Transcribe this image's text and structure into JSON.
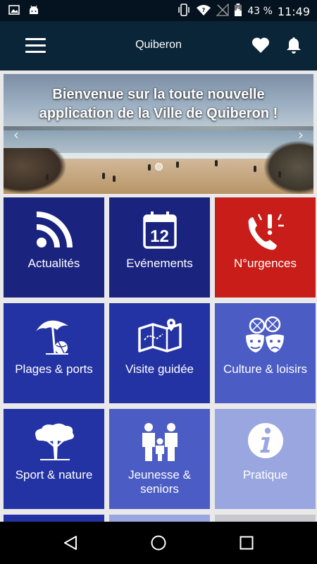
{
  "status_bar": {
    "battery_percent": "43 %",
    "time": "11:49",
    "icons": [
      "gallery-icon",
      "android-icon",
      "vibrate-icon",
      "wifi-icon",
      "no-signal-icon",
      "battery-charging-icon"
    ]
  },
  "app_bar": {
    "title": "Quiberon",
    "menu_icon": "hamburger-icon",
    "favorite_icon": "heart-icon",
    "notification_icon": "bell-icon"
  },
  "banner": {
    "headline_line1": "Bienvenue sur la toute nouvelle",
    "headline_line2": "application de la Ville de Quiberon !",
    "prev_icon": "chevron-left-icon",
    "next_icon": "chevron-right-icon"
  },
  "tiles": [
    {
      "label": "Actualités",
      "icon": "rss-icon",
      "color": "#1a237e"
    },
    {
      "label": "Evénements",
      "icon": "calendar-icon",
      "calendar_day": "12",
      "color": "#1a237e"
    },
    {
      "label": "N°urgences",
      "icon": "emergency-phone-icon",
      "color": "#c81d18"
    },
    {
      "label": "Plages & ports",
      "icon": "beach-umbrella-icon",
      "color": "#2433a3"
    },
    {
      "label": "Visite guidée",
      "icon": "map-icon",
      "color": "#2433a3"
    },
    {
      "label": "Culture & loisirs",
      "icon": "theater-masks-icon",
      "color": "#4b5cc4"
    },
    {
      "label": "Sport & nature",
      "icon": "tree-icon",
      "color": "#2433a3"
    },
    {
      "label": "Jeunesse & seniors",
      "icon": "family-icon",
      "color": "#4b5cc4"
    },
    {
      "label": "Pratique",
      "icon": "info-icon",
      "color": "#9aa6e0"
    }
  ],
  "nav_bar": {
    "back_icon": "back-triangle-icon",
    "home_icon": "home-circle-icon",
    "recents_icon": "recents-square-icon"
  }
}
